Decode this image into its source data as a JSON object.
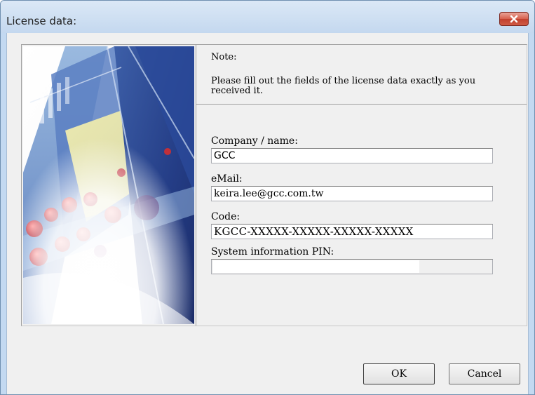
{
  "window": {
    "title": "License data:",
    "close_icon": "close-icon"
  },
  "note": {
    "title": "Note:",
    "text": "Please fill out the fields of the license data exactly as you received it."
  },
  "fields": {
    "company": {
      "label": "Company / name:",
      "value": "GCC"
    },
    "email": {
      "label": "eMail:",
      "value": "keira.lee@gcc.com.tw"
    },
    "code": {
      "label": "Code:",
      "value": "KGCC-XXXXX-XXXXX-XXXXX-XXXXX"
    },
    "pin": {
      "label": "System information PIN:",
      "value": ""
    }
  },
  "buttons": {
    "ok": "OK",
    "cancel": "Cancel"
  },
  "colors": {
    "titlebar": "#c4d8ef",
    "close_button": "#c9503c",
    "dialog_bg": "#f0f0f0"
  }
}
